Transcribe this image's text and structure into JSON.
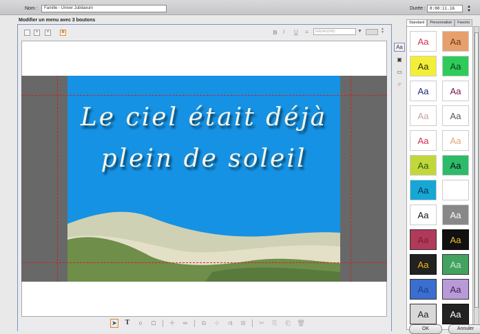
{
  "header": {
    "name_label": "Nom :",
    "name_value": "Famille - Univer Jubilaeum",
    "duration_label": "Durée :",
    "duration_value": "0:00:11.16"
  },
  "editor": {
    "title": "Modifier un menu avec 3 boutons",
    "bold": "B",
    "italic": "I",
    "underline": "U",
    "align": "≡",
    "font_name": "RADAGUND",
    "menu_text_line1": "Le ciel était déjà",
    "menu_text_line2": "plein de soleil"
  },
  "right_panel": {
    "tabs": [
      "Standard",
      "Personnalisé",
      "Favoris"
    ],
    "swatch_text": "Aa",
    "swatches": [
      {
        "fg": "#d62b4a",
        "bg": "#ffffff",
        "border": "#ccc"
      },
      {
        "fg": "#6b3a13",
        "bg": "#e7a06c",
        "border": "#ccc"
      },
      {
        "fg": "#2b2b10",
        "bg": "#f3ee39",
        "border": "#ccc"
      },
      {
        "fg": "#0c3d17",
        "bg": "#2fcb5a",
        "border": "#ccc"
      },
      {
        "fg": "#142a72",
        "bg": "#ffffff",
        "border": "#ccc"
      },
      {
        "fg": "#7c0f4c",
        "bg": "#ffffff",
        "border": "#ccc"
      },
      {
        "fg": "#c4a0a0",
        "bg": "#ffffff",
        "border": "#ccc"
      },
      {
        "fg": "#555555",
        "bg": "#ffffff",
        "border": "#ccc"
      },
      {
        "fg": "#d6294f",
        "bg": "#ffffff",
        "border": "#ccc"
      },
      {
        "fg": "#e9a36d",
        "bg": "#ffffff",
        "border": "#ccc"
      },
      {
        "fg": "#1d5d10",
        "bg": "#c2d73a",
        "border": "#ccc"
      },
      {
        "fg": "#101010",
        "bg": "#2dbb6a",
        "border": "#ccc"
      },
      {
        "fg": "#0b2a52",
        "bg": "#17a7d4",
        "border": "#ccc"
      },
      {
        "fg": "#ffffff",
        "bg": "#ffffff",
        "border": "#ccc"
      },
      {
        "fg": "#111111",
        "bg": "#ffffff",
        "border": "#ccc"
      },
      {
        "fg": "#ffffff",
        "bg": "#888888",
        "border": "#ccc"
      },
      {
        "fg": "#7b1a30",
        "bg": "#b03a5a",
        "border": "#333"
      },
      {
        "fg": "#f0c030",
        "bg": "#111111",
        "border": "#111"
      },
      {
        "fg": "#f5b81a",
        "bg": "#222222",
        "border": "#111"
      },
      {
        "fg": "#cde9cf",
        "bg": "#42a360",
        "border": "#333"
      },
      {
        "fg": "#1a3d8a",
        "bg": "#3a6fd0",
        "border": "#333"
      },
      {
        "fg": "#3a1f52",
        "bg": "#b89ad8",
        "border": "#333"
      },
      {
        "fg": "#222222",
        "bg": "#d8d8d8",
        "border": "#333"
      },
      {
        "fg": "#ffffff",
        "bg": "#222222",
        "border": "#111"
      }
    ]
  },
  "buttons": {
    "ok": "OK",
    "cancel": "Annuler"
  }
}
